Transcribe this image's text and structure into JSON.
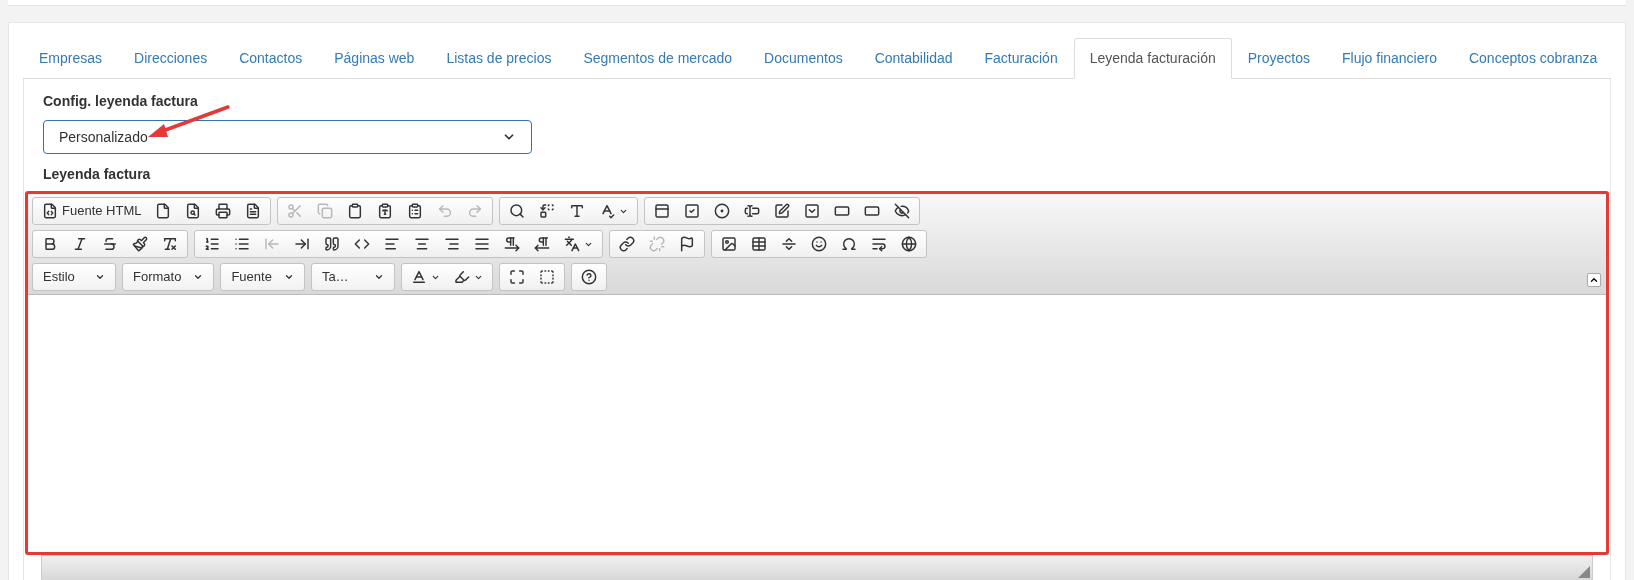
{
  "tabs": [
    {
      "label": "Empresas",
      "selected": false
    },
    {
      "label": "Direcciones",
      "selected": false
    },
    {
      "label": "Contactos",
      "selected": false
    },
    {
      "label": "Páginas web",
      "selected": false
    },
    {
      "label": "Listas de precios",
      "selected": false
    },
    {
      "label": "Segmentos de mercado",
      "selected": false
    },
    {
      "label": "Documentos",
      "selected": false
    },
    {
      "label": "Contabilidad",
      "selected": false
    },
    {
      "label": "Facturación",
      "selected": false
    },
    {
      "label": "Leyenda facturación",
      "selected": true
    },
    {
      "label": "Proyectos",
      "selected": false
    },
    {
      "label": "Flujo financiero",
      "selected": false
    },
    {
      "label": "Conceptos cobranza",
      "selected": false
    }
  ],
  "config_field": {
    "label": "Config. leyenda factura",
    "value": "Personalizado"
  },
  "editor": {
    "label": "Leyenda factura",
    "toolbar_rows": [
      [
        [
          {
            "kind": "source",
            "label": "Fuente HTML",
            "disabled": false
          },
          {
            "kind": "newpage",
            "disabled": false
          },
          {
            "kind": "preview",
            "disabled": false
          },
          {
            "kind": "print",
            "disabled": false
          },
          {
            "kind": "templates",
            "disabled": false
          }
        ],
        [
          {
            "kind": "cut",
            "disabled": true
          },
          {
            "kind": "copy",
            "disabled": true
          },
          {
            "kind": "paste",
            "disabled": false
          },
          {
            "kind": "pastetext",
            "disabled": false
          },
          {
            "kind": "pasteword",
            "disabled": false
          },
          {
            "kind": "undo",
            "disabled": true
          },
          {
            "kind": "redo",
            "disabled": true
          }
        ],
        [
          {
            "kind": "find",
            "disabled": false
          },
          {
            "kind": "replace",
            "disabled": false
          },
          {
            "kind": "selectall",
            "disabled": false
          },
          {
            "kind": "spellcheck",
            "disabled": false
          }
        ],
        [
          {
            "kind": "form",
            "disabled": false
          },
          {
            "kind": "checkbox",
            "disabled": false
          },
          {
            "kind": "radio",
            "disabled": false
          },
          {
            "kind": "textfield",
            "disabled": false
          },
          {
            "kind": "textarea",
            "disabled": false
          },
          {
            "kind": "select",
            "disabled": false
          },
          {
            "kind": "button",
            "disabled": false
          },
          {
            "kind": "imagebutton",
            "disabled": false
          },
          {
            "kind": "hiddenfield",
            "disabled": false
          }
        ]
      ],
      [
        [
          {
            "kind": "bold",
            "disabled": false
          },
          {
            "kind": "italic",
            "disabled": false
          },
          {
            "kind": "strike",
            "disabled": false
          },
          {
            "kind": "copyformat",
            "disabled": false
          },
          {
            "kind": "removeformat",
            "disabled": false
          }
        ],
        [
          {
            "kind": "numberedlist",
            "disabled": false
          },
          {
            "kind": "bulletedlist",
            "disabled": false
          },
          {
            "kind": "outdent",
            "disabled": true
          },
          {
            "kind": "indent",
            "disabled": false
          },
          {
            "kind": "blockquote",
            "disabled": false
          },
          {
            "kind": "creatediv",
            "disabled": false
          },
          {
            "kind": "alignleft",
            "disabled": false
          },
          {
            "kind": "aligncenter",
            "disabled": false
          },
          {
            "kind": "alignright",
            "disabled": false
          },
          {
            "kind": "justify",
            "disabled": false
          },
          {
            "kind": "ltr",
            "disabled": false
          },
          {
            "kind": "rtl",
            "disabled": false
          },
          {
            "kind": "language",
            "disabled": false
          }
        ],
        [
          {
            "kind": "link",
            "disabled": false
          },
          {
            "kind": "unlink",
            "disabled": true
          },
          {
            "kind": "anchor",
            "disabled": false
          }
        ],
        [
          {
            "kind": "image",
            "disabled": false
          },
          {
            "kind": "table",
            "disabled": false
          },
          {
            "kind": "hr",
            "disabled": false
          },
          {
            "kind": "smiley",
            "disabled": false
          },
          {
            "kind": "specialchar",
            "disabled": false
          },
          {
            "kind": "pagebreak",
            "disabled": false
          },
          {
            "kind": "iframe",
            "disabled": false
          }
        ]
      ],
      [
        [
          {
            "kind": "combo",
            "label": "Estilo",
            "disabled": false
          }
        ],
        [
          {
            "kind": "combo",
            "label": "Formato",
            "disabled": false
          }
        ],
        [
          {
            "kind": "combo",
            "label": "Fuente",
            "disabled": false
          }
        ],
        [
          {
            "kind": "combo",
            "label": "Ta…",
            "disabled": false
          }
        ],
        [
          {
            "kind": "textcolor",
            "disabled": false
          },
          {
            "kind": "bgcolor",
            "disabled": false
          }
        ],
        [
          {
            "kind": "maximize",
            "disabled": false
          },
          {
            "kind": "showblocks",
            "disabled": false
          }
        ],
        [
          {
            "kind": "about",
            "disabled": false
          }
        ]
      ]
    ]
  }
}
